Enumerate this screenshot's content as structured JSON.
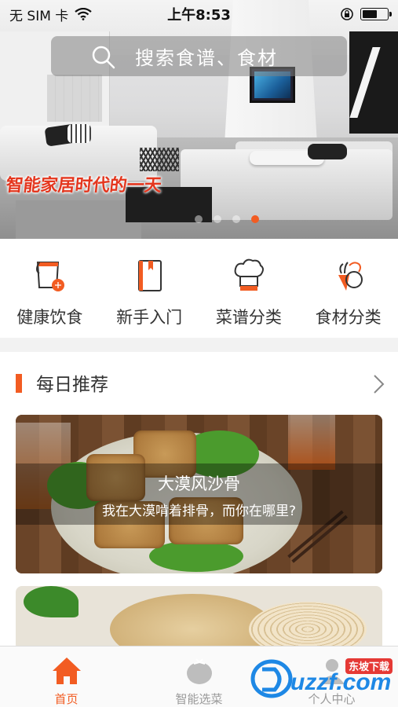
{
  "status_bar": {
    "carrier": "无 SIM 卡",
    "time": "上午8:53",
    "battery_level": 0.6
  },
  "banner": {
    "caption": "智能家居时代的一天",
    "slide_count": 4,
    "active_slide": 4
  },
  "search": {
    "placeholder": "搜索食谱、食材",
    "icon": "search-icon"
  },
  "categories": [
    {
      "label": "健康饮食",
      "icon": "cup-apple-icon"
    },
    {
      "label": "新手入门",
      "icon": "book-icon"
    },
    {
      "label": "菜谱分类",
      "icon": "chef-hat-icon"
    },
    {
      "label": "食材分类",
      "icon": "vegetables-icon"
    }
  ],
  "section": {
    "title": "每日推荐",
    "more_icon": "chevron-right-icon"
  },
  "recipes": [
    {
      "title": "大漠风沙骨",
      "subtitle": "我在大漠啃着排骨，而你在哪里?"
    },
    {
      "title": "",
      "subtitle": ""
    }
  ],
  "tab_bar": {
    "tabs": [
      {
        "label": "首页",
        "icon": "home-icon",
        "active": true
      },
      {
        "label": "智能选菜",
        "icon": "tomato-icon",
        "active": false
      },
      {
        "label": "个人中心",
        "icon": "person-icon",
        "active": false
      }
    ]
  },
  "watermark": {
    "brand": "uzzf.com",
    "tag": "东坡下载"
  },
  "colors": {
    "accent": "#f25c22",
    "inactive_tab": "#999999"
  }
}
